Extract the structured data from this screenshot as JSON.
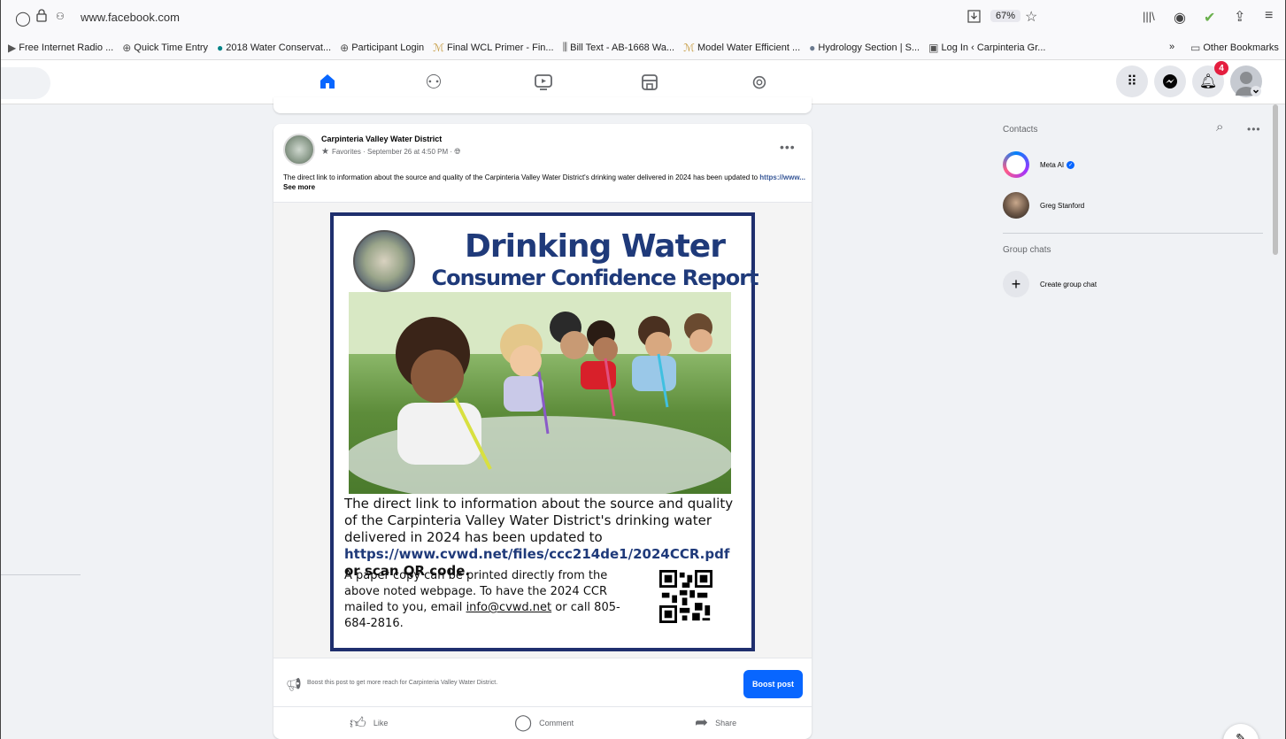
{
  "browser": {
    "url": "www.facebook.com",
    "zoom": "67%",
    "bookmarks": [
      {
        "icon": "play-icon",
        "label": "Free Internet Radio ..."
      },
      {
        "icon": "globe-icon",
        "label": "Quick Time Entry"
      },
      {
        "icon": "sharepoint-icon",
        "label": "2018 Water Conservat..."
      },
      {
        "icon": "globe-icon",
        "label": "Participant Login"
      },
      {
        "icon": "doc-icon",
        "label": "Final WCL Primer - Fin..."
      },
      {
        "icon": "bill-icon",
        "label": "Bill Text - AB-1668 Wa..."
      },
      {
        "icon": "doc-icon",
        "label": "Model Water Efficient ..."
      },
      {
        "icon": "hydrology-icon",
        "label": "Hydrology Section | S..."
      },
      {
        "icon": "login-icon",
        "label": "Log In ‹ Carpinteria Gr..."
      }
    ],
    "other_bookmarks": "Other Bookmarks"
  },
  "header": {
    "notification_count": "4"
  },
  "post": {
    "page_name": "Carpinteria Valley Water District",
    "favorites": "Favorites",
    "timestamp": "September 26 at 4:50 PM",
    "text_main": "The direct link to information about the source and quality of the Carpinteria Valley Water District's drinking water delivered in 2024 has been updated to ",
    "text_link": "https://www...",
    "see_more": "See more",
    "flyer": {
      "title": "Drinking Water",
      "subtitle": "Consumer Confidence Report",
      "body": "The direct link to information about the source and quality of the Carpinteria Valley Water District's drinking water delivered in 2024 has been updated to",
      "url": "https://www.cvwd.net/files/ccc214de1/2024CCR.pdf",
      "or_scan": "or scan QR code.",
      "paper_text": "A paper copy can be printed directly from the above noted webpage. To have the 2024 CCR mailed to you, email ",
      "email": "info@cvwd.net",
      "call": " or call 805-684-2816."
    },
    "boost_text": "Boost this post to get more reach for Carpinteria Valley Water District.",
    "boost_button": "Boost post",
    "actions": {
      "like": "Like",
      "comment": "Comment",
      "share": "Share"
    }
  },
  "sidebar_right": {
    "contacts_heading": "Contacts",
    "contacts": [
      {
        "name": "Meta AI",
        "verified": true
      },
      {
        "name": "Greg Stanford"
      }
    ],
    "group_chats_heading": "Group chats",
    "create_group_chat": "Create group chat"
  },
  "colors": {
    "fb_blue": "#0866ff",
    "flyer_navy": "#1f3a7a",
    "notification_red": "#e41e3f"
  }
}
